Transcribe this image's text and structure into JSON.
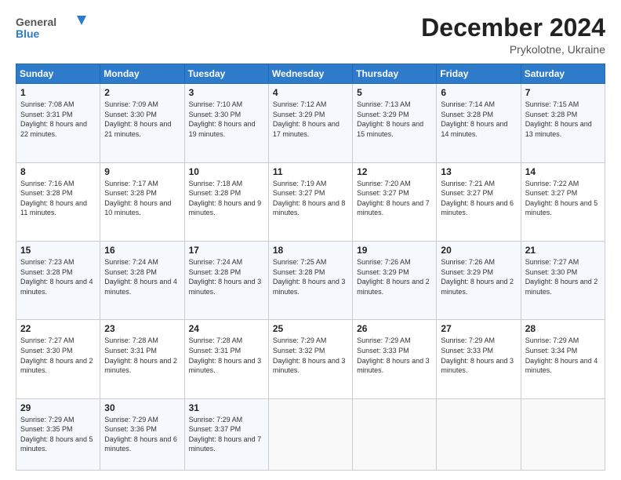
{
  "logo": {
    "line1": "General",
    "line2": "Blue"
  },
  "title": "December 2024",
  "subtitle": "Prykolotne, Ukraine",
  "days_header": [
    "Sunday",
    "Monday",
    "Tuesday",
    "Wednesday",
    "Thursday",
    "Friday",
    "Saturday"
  ],
  "weeks": [
    [
      {
        "day": "1",
        "sunrise": "7:08 AM",
        "sunset": "3:31 PM",
        "daylight": "8 hours and 22 minutes."
      },
      {
        "day": "2",
        "sunrise": "7:09 AM",
        "sunset": "3:30 PM",
        "daylight": "8 hours and 21 minutes."
      },
      {
        "day": "3",
        "sunrise": "7:10 AM",
        "sunset": "3:30 PM",
        "daylight": "8 hours and 19 minutes."
      },
      {
        "day": "4",
        "sunrise": "7:12 AM",
        "sunset": "3:29 PM",
        "daylight": "8 hours and 17 minutes."
      },
      {
        "day": "5",
        "sunrise": "7:13 AM",
        "sunset": "3:29 PM",
        "daylight": "8 hours and 15 minutes."
      },
      {
        "day": "6",
        "sunrise": "7:14 AM",
        "sunset": "3:28 PM",
        "daylight": "8 hours and 14 minutes."
      },
      {
        "day": "7",
        "sunrise": "7:15 AM",
        "sunset": "3:28 PM",
        "daylight": "8 hours and 13 minutes."
      }
    ],
    [
      {
        "day": "8",
        "sunrise": "7:16 AM",
        "sunset": "3:28 PM",
        "daylight": "8 hours and 11 minutes."
      },
      {
        "day": "9",
        "sunrise": "7:17 AM",
        "sunset": "3:28 PM",
        "daylight": "8 hours and 10 minutes."
      },
      {
        "day": "10",
        "sunrise": "7:18 AM",
        "sunset": "3:28 PM",
        "daylight": "8 hours and 9 minutes."
      },
      {
        "day": "11",
        "sunrise": "7:19 AM",
        "sunset": "3:27 PM",
        "daylight": "8 hours and 8 minutes."
      },
      {
        "day": "12",
        "sunrise": "7:20 AM",
        "sunset": "3:27 PM",
        "daylight": "8 hours and 7 minutes."
      },
      {
        "day": "13",
        "sunrise": "7:21 AM",
        "sunset": "3:27 PM",
        "daylight": "8 hours and 6 minutes."
      },
      {
        "day": "14",
        "sunrise": "7:22 AM",
        "sunset": "3:27 PM",
        "daylight": "8 hours and 5 minutes."
      }
    ],
    [
      {
        "day": "15",
        "sunrise": "7:23 AM",
        "sunset": "3:28 PM",
        "daylight": "8 hours and 4 minutes."
      },
      {
        "day": "16",
        "sunrise": "7:24 AM",
        "sunset": "3:28 PM",
        "daylight": "8 hours and 4 minutes."
      },
      {
        "day": "17",
        "sunrise": "7:24 AM",
        "sunset": "3:28 PM",
        "daylight": "8 hours and 3 minutes."
      },
      {
        "day": "18",
        "sunrise": "7:25 AM",
        "sunset": "3:28 PM",
        "daylight": "8 hours and 3 minutes."
      },
      {
        "day": "19",
        "sunrise": "7:26 AM",
        "sunset": "3:29 PM",
        "daylight": "8 hours and 2 minutes."
      },
      {
        "day": "20",
        "sunrise": "7:26 AM",
        "sunset": "3:29 PM",
        "daylight": "8 hours and 2 minutes."
      },
      {
        "day": "21",
        "sunrise": "7:27 AM",
        "sunset": "3:30 PM",
        "daylight": "8 hours and 2 minutes."
      }
    ],
    [
      {
        "day": "22",
        "sunrise": "7:27 AM",
        "sunset": "3:30 PM",
        "daylight": "8 hours and 2 minutes."
      },
      {
        "day": "23",
        "sunrise": "7:28 AM",
        "sunset": "3:31 PM",
        "daylight": "8 hours and 2 minutes."
      },
      {
        "day": "24",
        "sunrise": "7:28 AM",
        "sunset": "3:31 PM",
        "daylight": "8 hours and 3 minutes."
      },
      {
        "day": "25",
        "sunrise": "7:29 AM",
        "sunset": "3:32 PM",
        "daylight": "8 hours and 3 minutes."
      },
      {
        "day": "26",
        "sunrise": "7:29 AM",
        "sunset": "3:33 PM",
        "daylight": "8 hours and 3 minutes."
      },
      {
        "day": "27",
        "sunrise": "7:29 AM",
        "sunset": "3:33 PM",
        "daylight": "8 hours and 3 minutes."
      },
      {
        "day": "28",
        "sunrise": "7:29 AM",
        "sunset": "3:34 PM",
        "daylight": "8 hours and 4 minutes."
      }
    ],
    [
      {
        "day": "29",
        "sunrise": "7:29 AM",
        "sunset": "3:35 PM",
        "daylight": "8 hours and 5 minutes."
      },
      {
        "day": "30",
        "sunrise": "7:29 AM",
        "sunset": "3:36 PM",
        "daylight": "8 hours and 6 minutes."
      },
      {
        "day": "31",
        "sunrise": "7:29 AM",
        "sunset": "3:37 PM",
        "daylight": "8 hours and 7 minutes."
      },
      null,
      null,
      null,
      null
    ]
  ],
  "labels": {
    "sunrise": "Sunrise:",
    "sunset": "Sunset:",
    "daylight": "Daylight:"
  }
}
